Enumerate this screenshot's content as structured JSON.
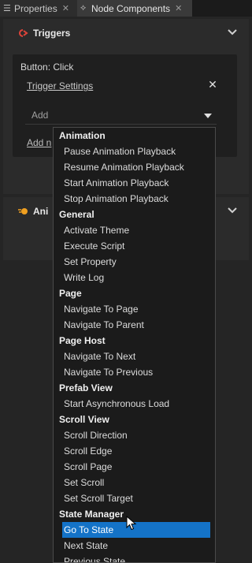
{
  "tabs": [
    {
      "icon": "list-icon",
      "label": "Properties",
      "close": "✕"
    },
    {
      "icon": "node-components-icon",
      "label": "Node Components",
      "close": "✕"
    }
  ],
  "triggers_section": {
    "title": "Triggers",
    "trigger_name": "Button: Click",
    "trigger_settings": "Trigger Settings",
    "close_symbol": "✕",
    "add_placeholder": "Add",
    "add_link": "Add n"
  },
  "animations_section": {
    "title": "Ani"
  },
  "dropdown": {
    "groups": [
      {
        "header": "Animation",
        "items": [
          "Pause Animation Playback",
          "Resume Animation Playback",
          "Start Animation Playback",
          "Stop Animation Playback"
        ]
      },
      {
        "header": "General",
        "items": [
          "Activate Theme",
          "Execute Script",
          "Set Property",
          "Write Log"
        ]
      },
      {
        "header": "Page",
        "items": [
          "Navigate To Page",
          "Navigate To Parent"
        ]
      },
      {
        "header": "Page Host",
        "items": [
          "Navigate To Next",
          "Navigate To Previous"
        ]
      },
      {
        "header": "Prefab View",
        "items": [
          "Start Asynchronous Load"
        ]
      },
      {
        "header": "Scroll View",
        "items": [
          "Scroll Direction",
          "Scroll Edge",
          "Scroll Page",
          "Set Scroll",
          "Set Scroll Target"
        ]
      },
      {
        "header": "State Manager",
        "items": [
          "Go To State",
          "Next State",
          "Previous State"
        ]
      }
    ],
    "selected_item": "Go To State"
  },
  "colors": {
    "selection": "#1473c8",
    "trigger_icon": "#e0443a",
    "animation_icon": "#f0a020"
  }
}
